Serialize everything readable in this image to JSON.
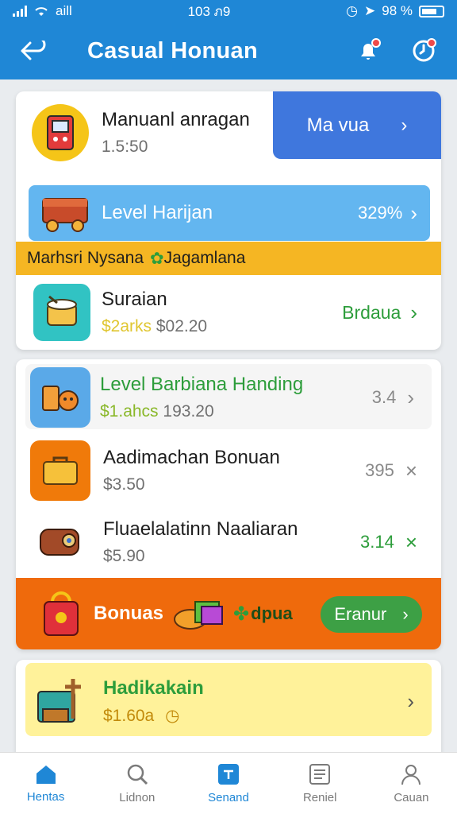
{
  "status_bar": {
    "carrier": "aill",
    "time": "103 ภ9",
    "battery_text": "98 %"
  },
  "header": {
    "title": "Casual Honuan"
  },
  "featured": {
    "title": "Manuanl anragan",
    "subtitle": "1.5:50",
    "button_label": "Ma vua"
  },
  "level_banner": {
    "label": "Level Harijan",
    "value": "329%"
  },
  "marquee": {
    "text": "Marhsri Nysana",
    "highlight": "Jagamlana"
  },
  "first_list": {
    "title": "Suraian",
    "sub_highlight": "$2arks",
    "sub_value": "$02.20",
    "action": "Brdaua"
  },
  "items": [
    {
      "title": "Level Barbiana Handing",
      "sub_highlight": "$1.ahcs",
      "sub_value": "193.20",
      "value": "3.4",
      "mark": "›"
    },
    {
      "title": "Aadimachan Bonuan",
      "sub_value": "$3.50",
      "value": "395",
      "mark": "×"
    },
    {
      "title": "Fluaelalatinn Naaliaran",
      "sub_value": "$5.90",
      "value": "3.14",
      "mark": "×"
    }
  ],
  "bonus": {
    "label": "Bonuas",
    "tag": "dpua",
    "button_label": "Eranur"
  },
  "last_card": {
    "title": "Hadikakain",
    "price": "$1.60a"
  },
  "nav": [
    {
      "label": "Hentas",
      "icon": "home-icon"
    },
    {
      "label": "Lidnon",
      "icon": "search-icon"
    },
    {
      "label": "Senand",
      "icon": "send-icon"
    },
    {
      "label": "Reniel",
      "icon": "list-icon"
    },
    {
      "label": "Cauan",
      "icon": "profile-icon"
    }
  ],
  "colors": {
    "primary": "#1f87d6",
    "feature": "#3f77dd",
    "accent_orange": "#ef6a0c",
    "accent_green": "#2d9d3b",
    "accent_yellow": "#f5b623"
  }
}
